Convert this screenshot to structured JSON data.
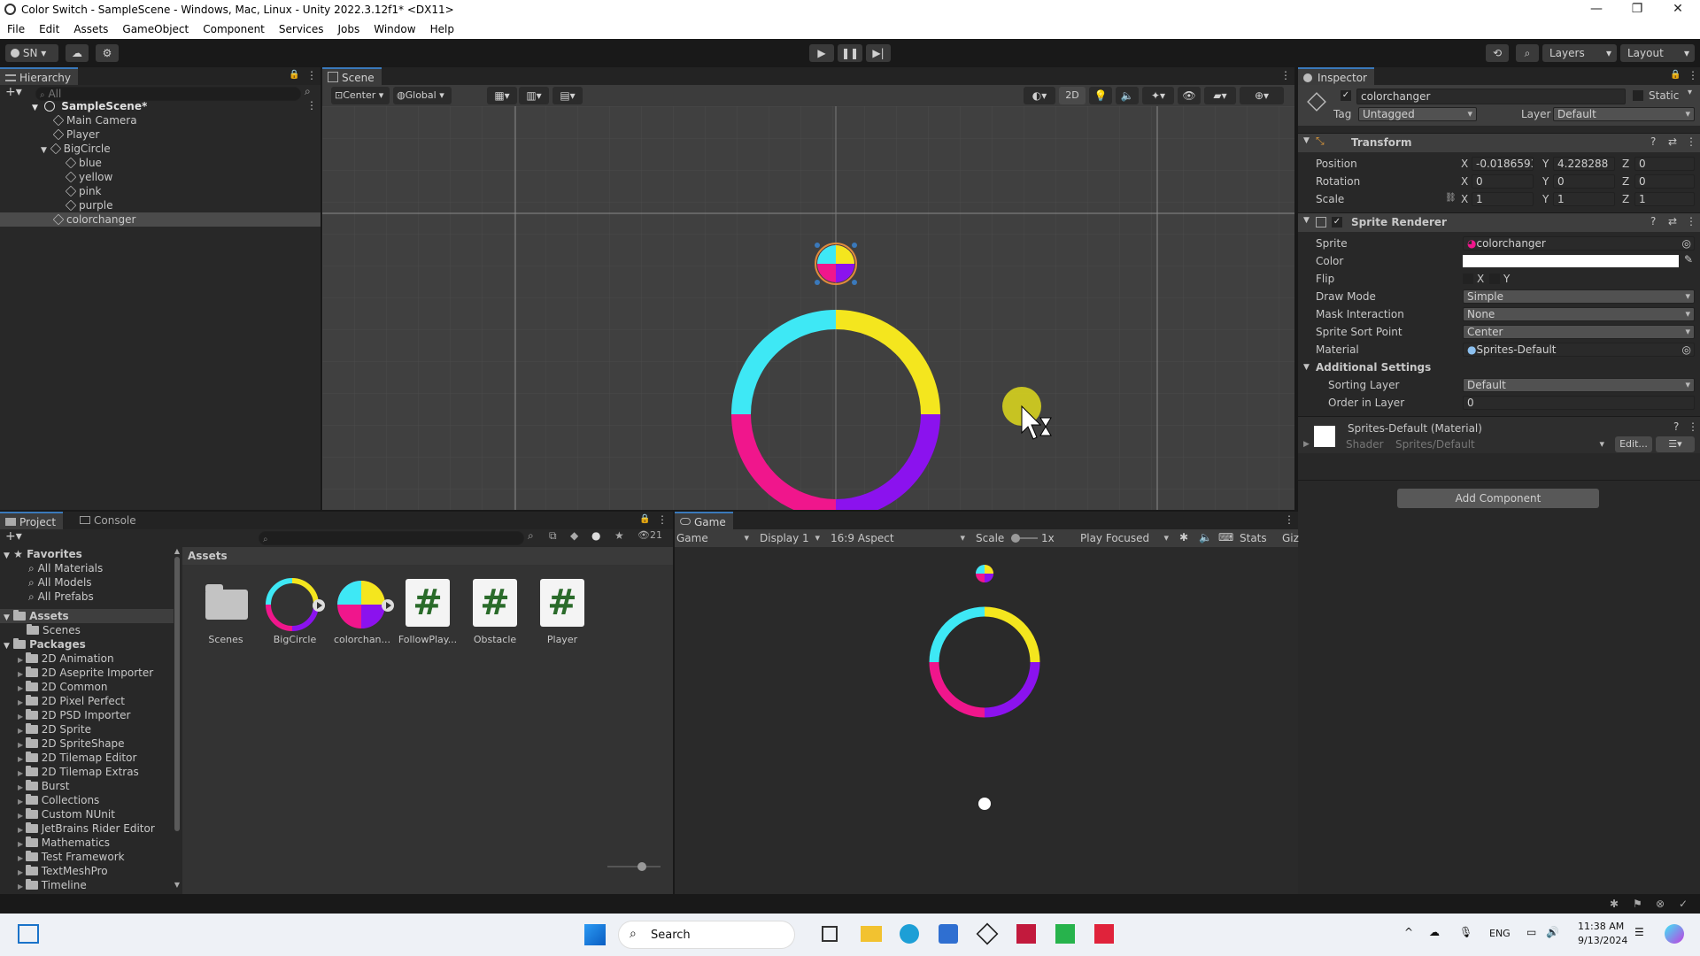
{
  "window": {
    "title": "Color Switch - SampleScene - Windows, Mac, Linux - Unity 2022.3.12f1* <DX11>"
  },
  "menu": [
    "File",
    "Edit",
    "Assets",
    "GameObject",
    "Component",
    "Services",
    "Jobs",
    "Window",
    "Help"
  ],
  "toolbar": {
    "account": "SN",
    "layers": "Layers",
    "layout": "Layout"
  },
  "hierarchy": {
    "tab": "Hierarchy",
    "search_placeholder": "All",
    "scene": "SampleScene*",
    "items": [
      "Main Camera",
      "Player",
      "BigCircle",
      "blue",
      "yellow",
      "pink",
      "purple",
      "colorchanger"
    ]
  },
  "scene": {
    "tab": "Scene",
    "pivot": "Center",
    "space": "Global",
    "mode_2d": "2D"
  },
  "inspector": {
    "tab": "Inspector",
    "object_name": "colorchanger",
    "static_label": "Static",
    "tag_label": "Tag",
    "tag_value": "Untagged",
    "layer_label": "Layer",
    "layer_value": "Default",
    "transform": {
      "title": "Transform",
      "position_label": "Position",
      "pos_x": "-0.0186593",
      "pos_y": "4.228288",
      "pos_z": "0",
      "rotation_label": "Rotation",
      "rot_x": "0",
      "rot_y": "0",
      "rot_z": "0",
      "scale_label": "Scale",
      "scale_x": "1",
      "scale_y": "1",
      "scale_z": "1",
      "x": "X",
      "y": "Y",
      "z": "Z"
    },
    "sprite_renderer": {
      "title": "Sprite Renderer",
      "sprite_label": "Sprite",
      "sprite_value": "colorchanger",
      "color_label": "Color",
      "flip_label": "Flip",
      "flip_x": "X",
      "flip_y": "Y",
      "draw_mode_label": "Draw Mode",
      "draw_mode_value": "Simple",
      "mask_label": "Mask Interaction",
      "mask_value": "None",
      "sort_point_label": "Sprite Sort Point",
      "sort_point_value": "Center",
      "material_label": "Material",
      "material_value": "Sprites-Default",
      "additional": "Additional Settings",
      "sorting_layer_label": "Sorting Layer",
      "sorting_layer_value": "Default",
      "order_label": "Order in Layer",
      "order_value": "0"
    },
    "material": {
      "title": "Sprites-Default (Material)",
      "shader_label": "Shader",
      "shader_value": "Sprites/Default",
      "edit": "Edit..."
    },
    "add_component": "Add Component"
  },
  "project": {
    "tab_project": "Project",
    "tab_console": "Console",
    "hidden_count": "21",
    "favorites_title": "Favorites",
    "favorites": [
      "All Materials",
      "All Models",
      "All Prefabs"
    ],
    "assets_title": "Assets",
    "assets_children": [
      "Scenes"
    ],
    "packages_title": "Packages",
    "packages": [
      "2D Animation",
      "2D Aseprite Importer",
      "2D Common",
      "2D Pixel Perfect",
      "2D PSD Importer",
      "2D Sprite",
      "2D SpriteShape",
      "2D Tilemap Editor",
      "2D Tilemap Extras",
      "Burst",
      "Collections",
      "Custom NUnit",
      "JetBrains Rider Editor",
      "Mathematics",
      "Test Framework",
      "TextMeshPro",
      "Timeline"
    ],
    "breadcrumb": "Assets",
    "asset_items": [
      "Scenes",
      "BigCircle",
      "colorchan...",
      "FollowPlay...",
      "Obstacle",
      "Player"
    ]
  },
  "game": {
    "tab": "Game",
    "mode": "Game",
    "display": "Display 1",
    "aspect": "16:9 Aspect",
    "scale_label": "Scale",
    "scale_value": "1x",
    "play_focused": "Play Focused",
    "stats": "Stats",
    "gizmos": "Giz"
  },
  "taskbar": {
    "search": "Search",
    "lang": "ENG",
    "time": "11:38 AM",
    "date": "9/13/2024"
  },
  "colors": {
    "cyan": "#3ee8f5",
    "yellow": "#f4e61e",
    "magenta": "#f0168c",
    "purple": "#8b12ee",
    "accent": "#3a79bb"
  }
}
